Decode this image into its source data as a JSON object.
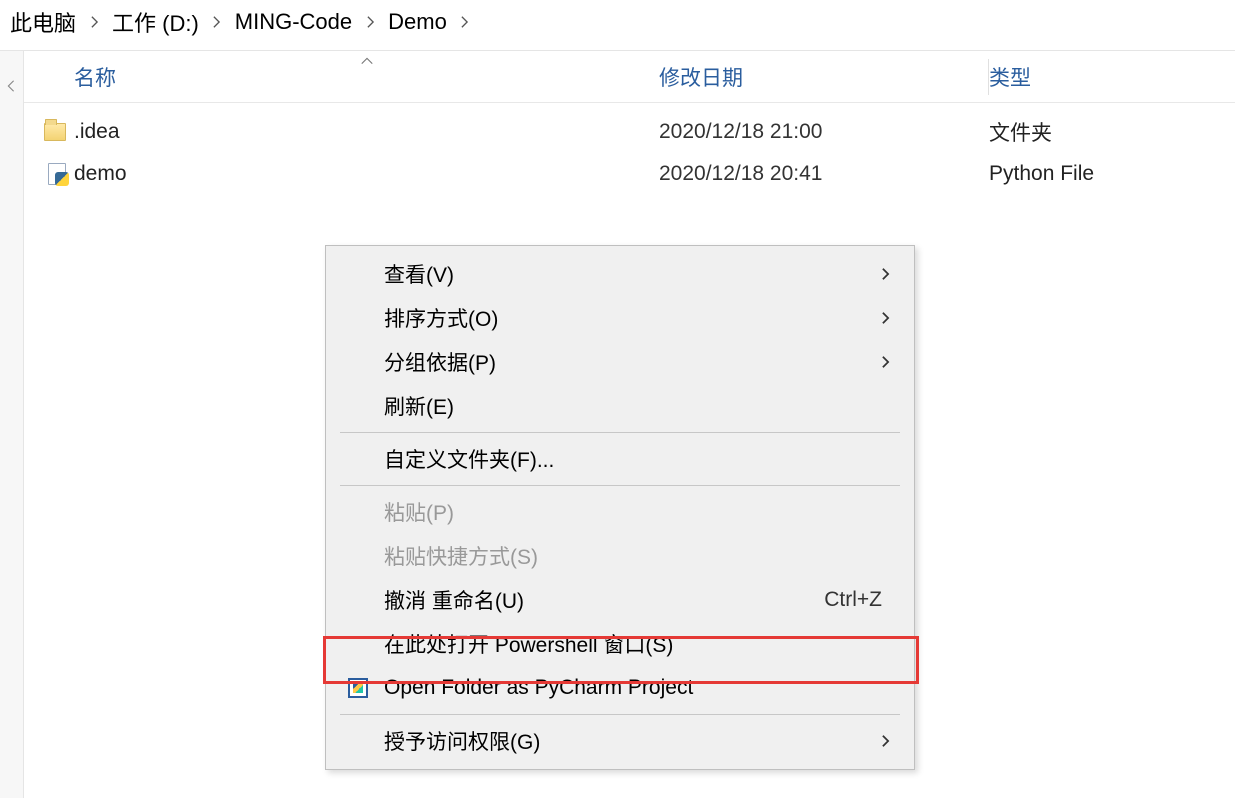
{
  "breadcrumb": {
    "items": [
      "此电脑",
      "工作 (D:)",
      "MING-Code",
      "Demo"
    ]
  },
  "columns": {
    "name": "名称",
    "date": "修改日期",
    "type": "类型"
  },
  "files": [
    {
      "name": ".idea",
      "date": "2020/12/18 21:00",
      "type": "文件夹",
      "icon": "folder"
    },
    {
      "name": "demo",
      "date": "2020/12/18 20:41",
      "type": "Python File",
      "icon": "python"
    }
  ],
  "contextMenu": {
    "items": [
      {
        "label": "查看(V)",
        "submenu": true
      },
      {
        "label": "排序方式(O)",
        "submenu": true
      },
      {
        "label": "分组依据(P)",
        "submenu": true
      },
      {
        "label": "刷新(E)"
      },
      {
        "sep": true
      },
      {
        "label": "自定义文件夹(F)..."
      },
      {
        "sep": true
      },
      {
        "label": "粘贴(P)",
        "disabled": true
      },
      {
        "label": "粘贴快捷方式(S)",
        "disabled": true
      },
      {
        "label": "撤消 重命名(U)",
        "shortcut": "Ctrl+Z"
      },
      {
        "label": "在此处打开 Powershell 窗口(S)",
        "highlight": true
      },
      {
        "label": "Open Folder as PyCharm Project",
        "icon": "pycharm"
      },
      {
        "sep": true
      },
      {
        "label": "授予访问权限(G)",
        "submenu": true
      }
    ]
  }
}
